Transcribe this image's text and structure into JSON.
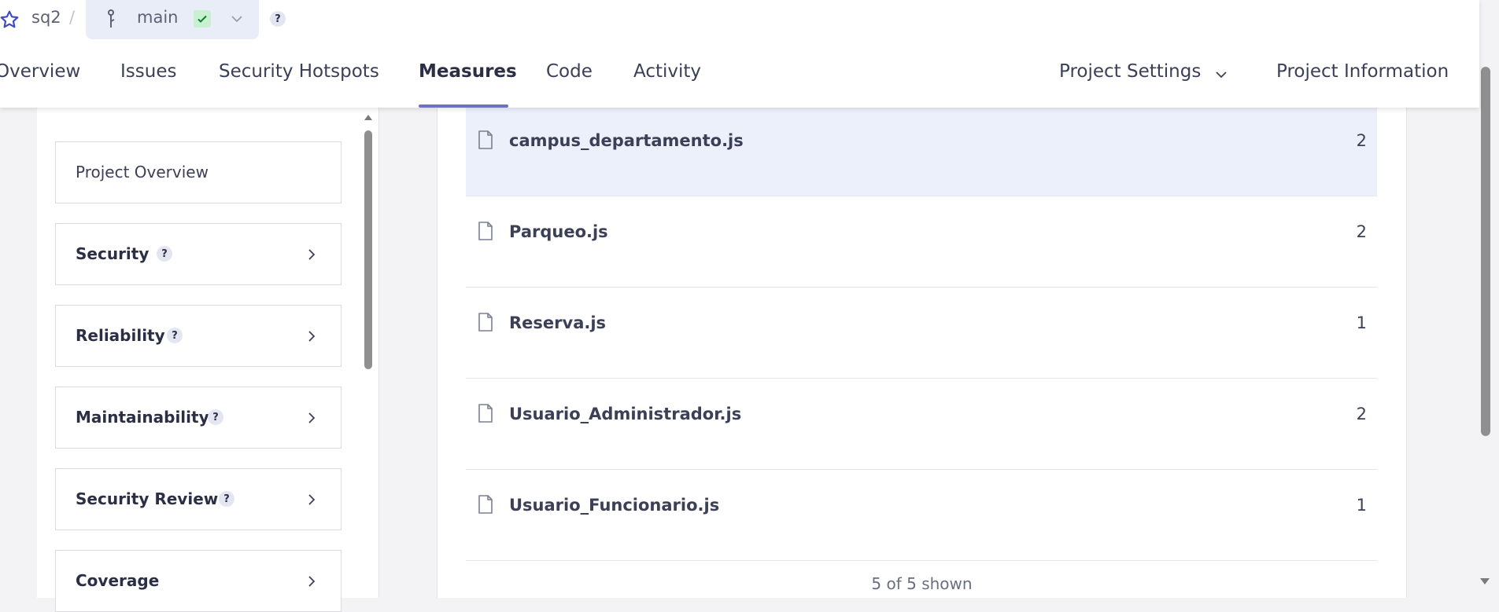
{
  "breadcrumb": {
    "project": "sq2",
    "separator": "/",
    "branch": "main",
    "help": "?"
  },
  "nav": {
    "items": [
      "Overview",
      "Issues",
      "Security Hotspots",
      "Measures",
      "Code",
      "Activity"
    ],
    "active": "Measures",
    "settings": "Project Settings",
    "information": "Project Information"
  },
  "sidebar": {
    "items": [
      {
        "label": "Project Overview",
        "help": false
      },
      {
        "label": "Security",
        "help": true
      },
      {
        "label": "Reliability",
        "help": true
      },
      {
        "label": "Maintainability",
        "help": true
      },
      {
        "label": "Security Review",
        "help": true
      },
      {
        "label": "Coverage",
        "help": false
      }
    ],
    "help_symbol": "?"
  },
  "files": {
    "rows": [
      {
        "name": "campus_departamento.js",
        "value": "2"
      },
      {
        "name": "Parqueo.js",
        "value": "2"
      },
      {
        "name": "Reserva.js",
        "value": "1"
      },
      {
        "name": "Usuario_Administrador.js",
        "value": "2"
      },
      {
        "name": "Usuario_Funcionario.js",
        "value": "1"
      }
    ],
    "shown": "5 of 5 shown"
  },
  "colors": {
    "accent": "#6b72c6",
    "selected_row": "#ecf0fb",
    "branch_bg": "#e9edf7",
    "success_badge": "#c9f0d1"
  }
}
